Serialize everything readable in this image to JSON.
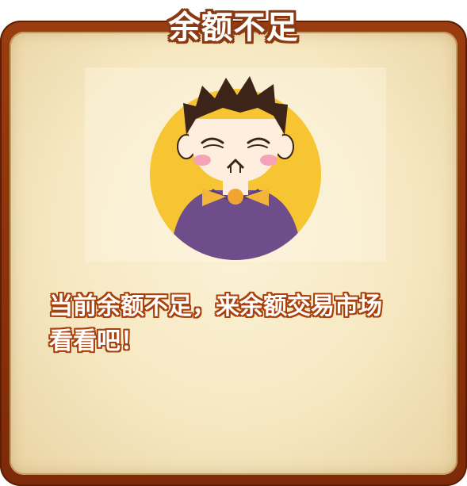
{
  "dialog": {
    "title": "余额不足",
    "message_line1": "当前余额不足，来余额交易市场",
    "message_line2": "看看吧！"
  },
  "illustration": {
    "icon": "sad-boy-avatar-icon",
    "circle_color": "#f6c531",
    "sweater_color": "#6f4d8a",
    "bowtie_color": "#f3b53c"
  },
  "colors": {
    "frame": "#8a3310",
    "parchment": "#f6e8c2",
    "text_outline": "#a8400c"
  }
}
